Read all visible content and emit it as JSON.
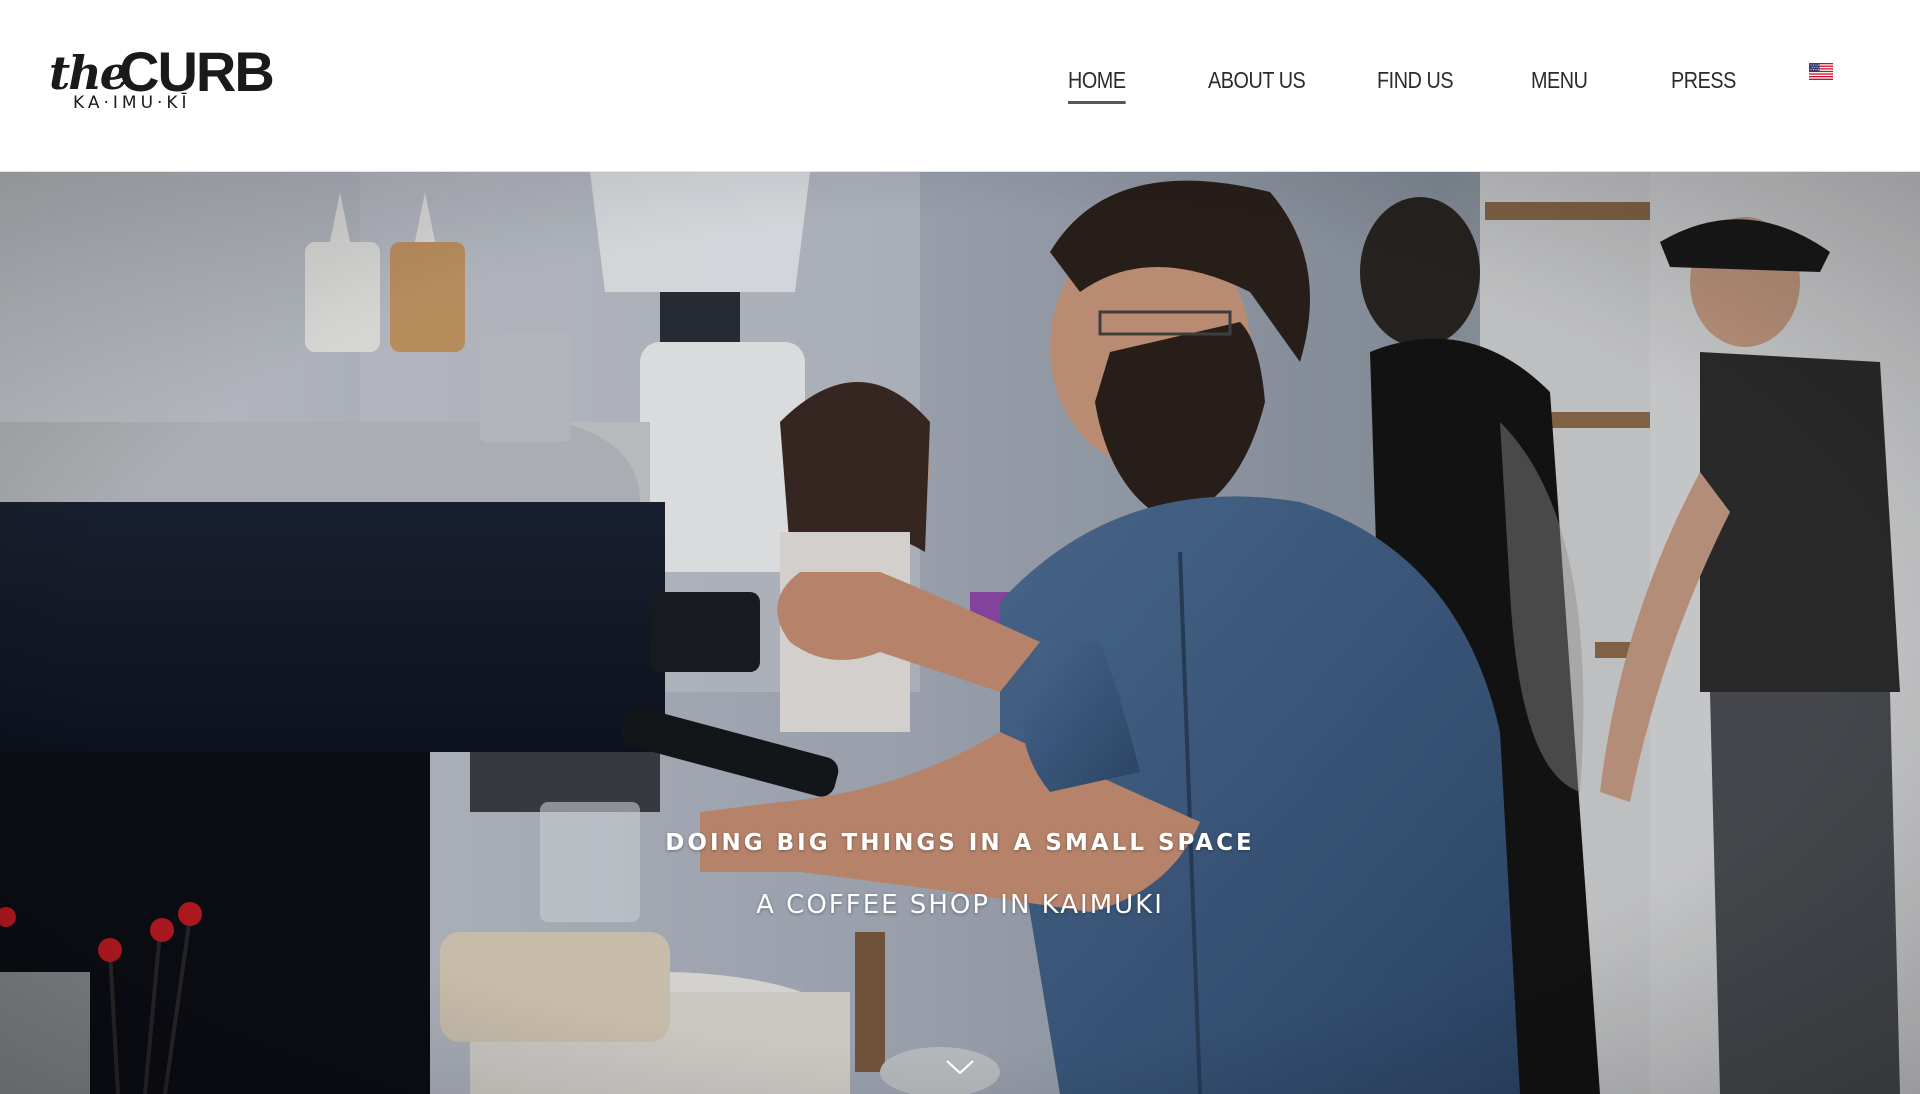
{
  "header": {
    "logo": {
      "the": "the",
      "curb": "CURB",
      "subtitle": "KA·IMU·KĪ"
    },
    "nav": {
      "items": [
        {
          "label": "HOME",
          "active": true
        },
        {
          "label": "ABOUT US",
          "active": false
        },
        {
          "label": "FIND US",
          "active": false
        },
        {
          "label": "MENU",
          "active": false
        },
        {
          "label": "PRESS",
          "active": false
        }
      ],
      "language_icon": "us-flag-icon"
    }
  },
  "hero": {
    "tagline": "DOING BIG THINGS IN A SMALL SPACE",
    "subtitle": "A COFFEE SHOP IN KAIMUKI",
    "scroll_icon": "chevron-down-icon"
  },
  "colors": {
    "nav_text": "#2b2b2b",
    "nav_active_underline": "#4d5a60",
    "hero_text": "#ffffff"
  }
}
